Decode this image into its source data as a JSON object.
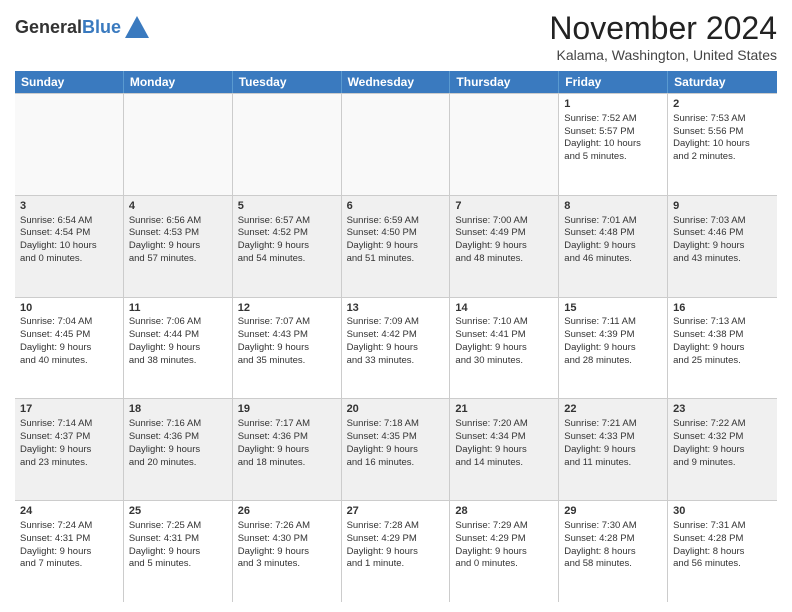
{
  "header": {
    "logo_line1": "General",
    "logo_line2": "Blue",
    "month": "November 2024",
    "location": "Kalama, Washington, United States"
  },
  "days_of_week": [
    "Sunday",
    "Monday",
    "Tuesday",
    "Wednesday",
    "Thursday",
    "Friday",
    "Saturday"
  ],
  "weeks": [
    [
      {
        "day": "",
        "info": ""
      },
      {
        "day": "",
        "info": ""
      },
      {
        "day": "",
        "info": ""
      },
      {
        "day": "",
        "info": ""
      },
      {
        "day": "",
        "info": ""
      },
      {
        "day": "1",
        "info": "Sunrise: 7:52 AM\nSunset: 5:57 PM\nDaylight: 10 hours\nand 5 minutes."
      },
      {
        "day": "2",
        "info": "Sunrise: 7:53 AM\nSunset: 5:56 PM\nDaylight: 10 hours\nand 2 minutes."
      }
    ],
    [
      {
        "day": "3",
        "info": "Sunrise: 6:54 AM\nSunset: 4:54 PM\nDaylight: 10 hours\nand 0 minutes."
      },
      {
        "day": "4",
        "info": "Sunrise: 6:56 AM\nSunset: 4:53 PM\nDaylight: 9 hours\nand 57 minutes."
      },
      {
        "day": "5",
        "info": "Sunrise: 6:57 AM\nSunset: 4:52 PM\nDaylight: 9 hours\nand 54 minutes."
      },
      {
        "day": "6",
        "info": "Sunrise: 6:59 AM\nSunset: 4:50 PM\nDaylight: 9 hours\nand 51 minutes."
      },
      {
        "day": "7",
        "info": "Sunrise: 7:00 AM\nSunset: 4:49 PM\nDaylight: 9 hours\nand 48 minutes."
      },
      {
        "day": "8",
        "info": "Sunrise: 7:01 AM\nSunset: 4:48 PM\nDaylight: 9 hours\nand 46 minutes."
      },
      {
        "day": "9",
        "info": "Sunrise: 7:03 AM\nSunset: 4:46 PM\nDaylight: 9 hours\nand 43 minutes."
      }
    ],
    [
      {
        "day": "10",
        "info": "Sunrise: 7:04 AM\nSunset: 4:45 PM\nDaylight: 9 hours\nand 40 minutes."
      },
      {
        "day": "11",
        "info": "Sunrise: 7:06 AM\nSunset: 4:44 PM\nDaylight: 9 hours\nand 38 minutes."
      },
      {
        "day": "12",
        "info": "Sunrise: 7:07 AM\nSunset: 4:43 PM\nDaylight: 9 hours\nand 35 minutes."
      },
      {
        "day": "13",
        "info": "Sunrise: 7:09 AM\nSunset: 4:42 PM\nDaylight: 9 hours\nand 33 minutes."
      },
      {
        "day": "14",
        "info": "Sunrise: 7:10 AM\nSunset: 4:41 PM\nDaylight: 9 hours\nand 30 minutes."
      },
      {
        "day": "15",
        "info": "Sunrise: 7:11 AM\nSunset: 4:39 PM\nDaylight: 9 hours\nand 28 minutes."
      },
      {
        "day": "16",
        "info": "Sunrise: 7:13 AM\nSunset: 4:38 PM\nDaylight: 9 hours\nand 25 minutes."
      }
    ],
    [
      {
        "day": "17",
        "info": "Sunrise: 7:14 AM\nSunset: 4:37 PM\nDaylight: 9 hours\nand 23 minutes."
      },
      {
        "day": "18",
        "info": "Sunrise: 7:16 AM\nSunset: 4:36 PM\nDaylight: 9 hours\nand 20 minutes."
      },
      {
        "day": "19",
        "info": "Sunrise: 7:17 AM\nSunset: 4:36 PM\nDaylight: 9 hours\nand 18 minutes."
      },
      {
        "day": "20",
        "info": "Sunrise: 7:18 AM\nSunset: 4:35 PM\nDaylight: 9 hours\nand 16 minutes."
      },
      {
        "day": "21",
        "info": "Sunrise: 7:20 AM\nSunset: 4:34 PM\nDaylight: 9 hours\nand 14 minutes."
      },
      {
        "day": "22",
        "info": "Sunrise: 7:21 AM\nSunset: 4:33 PM\nDaylight: 9 hours\nand 11 minutes."
      },
      {
        "day": "23",
        "info": "Sunrise: 7:22 AM\nSunset: 4:32 PM\nDaylight: 9 hours\nand 9 minutes."
      }
    ],
    [
      {
        "day": "24",
        "info": "Sunrise: 7:24 AM\nSunset: 4:31 PM\nDaylight: 9 hours\nand 7 minutes."
      },
      {
        "day": "25",
        "info": "Sunrise: 7:25 AM\nSunset: 4:31 PM\nDaylight: 9 hours\nand 5 minutes."
      },
      {
        "day": "26",
        "info": "Sunrise: 7:26 AM\nSunset: 4:30 PM\nDaylight: 9 hours\nand 3 minutes."
      },
      {
        "day": "27",
        "info": "Sunrise: 7:28 AM\nSunset: 4:29 PM\nDaylight: 9 hours\nand 1 minute."
      },
      {
        "day": "28",
        "info": "Sunrise: 7:29 AM\nSunset: 4:29 PM\nDaylight: 9 hours\nand 0 minutes."
      },
      {
        "day": "29",
        "info": "Sunrise: 7:30 AM\nSunset: 4:28 PM\nDaylight: 8 hours\nand 58 minutes."
      },
      {
        "day": "30",
        "info": "Sunrise: 7:31 AM\nSunset: 4:28 PM\nDaylight: 8 hours\nand 56 minutes."
      }
    ]
  ]
}
